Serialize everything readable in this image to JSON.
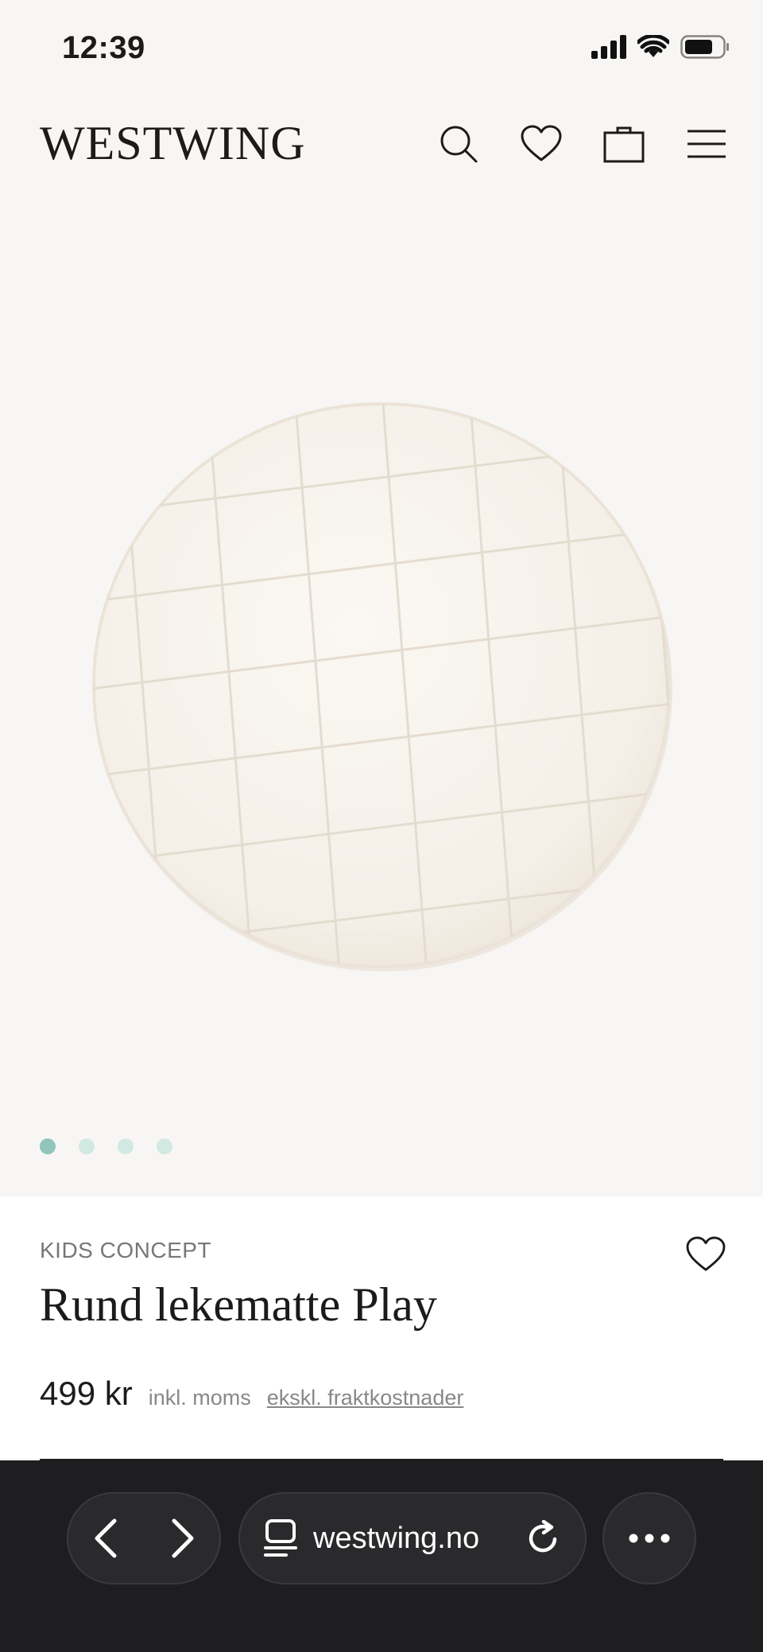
{
  "status_bar": {
    "time": "12:39"
  },
  "header": {
    "logo": "WESTWING",
    "icons": [
      "search-icon",
      "heart-icon",
      "bag-icon",
      "menu-icon"
    ]
  },
  "gallery": {
    "image_alt": "round quilted play mat",
    "slide_count": 4,
    "active_slide": 1,
    "dot_active_color": "#8fc5ba",
    "dot_color": "#d2e8e3"
  },
  "product": {
    "brand": "KIDS CONCEPT",
    "title": "Rund lekematte Play",
    "price": "499 kr",
    "vat_note": "inkl. moms",
    "shipping_note": "ekskl. fraktkostnader"
  },
  "browser": {
    "url": "westwing.no"
  }
}
